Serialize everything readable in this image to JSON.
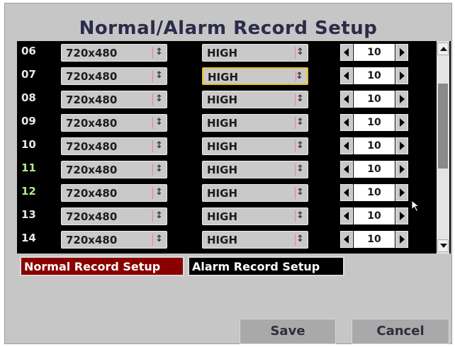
{
  "title": "Normal/Alarm Record Setup",
  "rows": [
    {
      "channel": "06",
      "resolution": "720x480",
      "quality": "HIGH",
      "rate": "10",
      "focused": false
    },
    {
      "channel": "07",
      "resolution": "720x480",
      "quality": "HIGH",
      "rate": "10",
      "focused": true
    },
    {
      "channel": "08",
      "resolution": "720x480",
      "quality": "HIGH",
      "rate": "10",
      "focused": false
    },
    {
      "channel": "09",
      "resolution": "720x480",
      "quality": "HIGH",
      "rate": "10",
      "focused": false
    },
    {
      "channel": "10",
      "resolution": "720x480",
      "quality": "HIGH",
      "rate": "10",
      "focused": false
    },
    {
      "channel": "11",
      "resolution": "720x480",
      "quality": "HIGH",
      "rate": "10",
      "focused": false
    },
    {
      "channel": "12",
      "resolution": "720x480",
      "quality": "HIGH",
      "rate": "10",
      "focused": false
    },
    {
      "channel": "13",
      "resolution": "720x480",
      "quality": "HIGH",
      "rate": "10",
      "focused": false
    },
    {
      "channel": "14",
      "resolution": "720x480",
      "quality": "HIGH",
      "rate": "10",
      "focused": false
    }
  ],
  "tabs": {
    "normal": "Normal Record Setup",
    "alarm": "Alarm Record Setup"
  },
  "buttons": {
    "save": "Save",
    "cancel": "Cancel"
  },
  "icons": {
    "select_arrows": "updown-arrows-icon",
    "stepper_left": "left-arrow-icon",
    "stepper_right": "right-arrow-icon",
    "scroll_up": "scroll-up-icon",
    "scroll_down": "scroll-down-icon",
    "cursor": "mouse-pointer-icon"
  },
  "colors": {
    "active_tab": "#8a0000",
    "focus_border": "#e6c31a",
    "table_background": "#000000"
  }
}
